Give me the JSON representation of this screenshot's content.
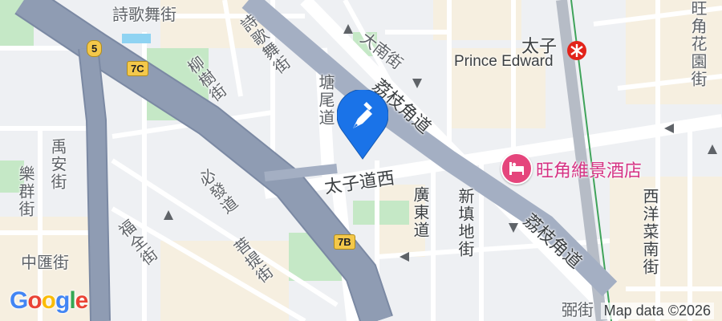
{
  "map": {
    "street_labels": {
      "poetry_top": "詩歌舞街",
      "poetry_diag": "詩歌舞街",
      "tai_nan": "大南街",
      "liu_shu": "柳樹街",
      "tong_mei": "塘尾道",
      "lai_chi_kok_1": "荔枝角道",
      "lai_chi_kok_2": "荔枝角道",
      "wang_kok_garden": "旺角花園街",
      "prince_edward_west": "太子道西",
      "kwong_tung": "廣東道",
      "sun_chun_tei": "新填地街",
      "sai_yeung_choi_south": "西洋菜南街",
      "bit_fat": "必發道",
      "fuk_chuen": "福全街",
      "po_tai": "菩提街",
      "yu_on": "禹安街",
      "lok_kwan": "樂群街",
      "chung_wui": "中匯街",
      "bottom_partial": "弼街"
    },
    "shields": {
      "route5": "5",
      "exit7c": "7C",
      "exit7b": "7B"
    },
    "station": {
      "name_zh": "太子",
      "name_en": "Prince Edward",
      "icon": "mtr-icon"
    },
    "hotel": {
      "name": "旺角維景酒店",
      "icon": "hotel-bed-icon"
    },
    "marker": {
      "icon": "location-pin-icon"
    },
    "logo": {
      "letters": [
        "G",
        "o",
        "o",
        "g",
        "l",
        "e"
      ]
    },
    "attribution": "Map data ©2026",
    "colors": {
      "highway": "#8f9cb3",
      "highway_edge": "#7b89a3",
      "park": "#c5e8c6",
      "hotel_pink": "#e5457c",
      "marker_blue": "#1a73e8",
      "mtr_red": "#e2231a",
      "rail_green": "#3fa35a",
      "logo_blue": "#4285f4",
      "logo_red": "#ea4335",
      "logo_yellow": "#fbbc05",
      "logo_green": "#34a853"
    }
  }
}
